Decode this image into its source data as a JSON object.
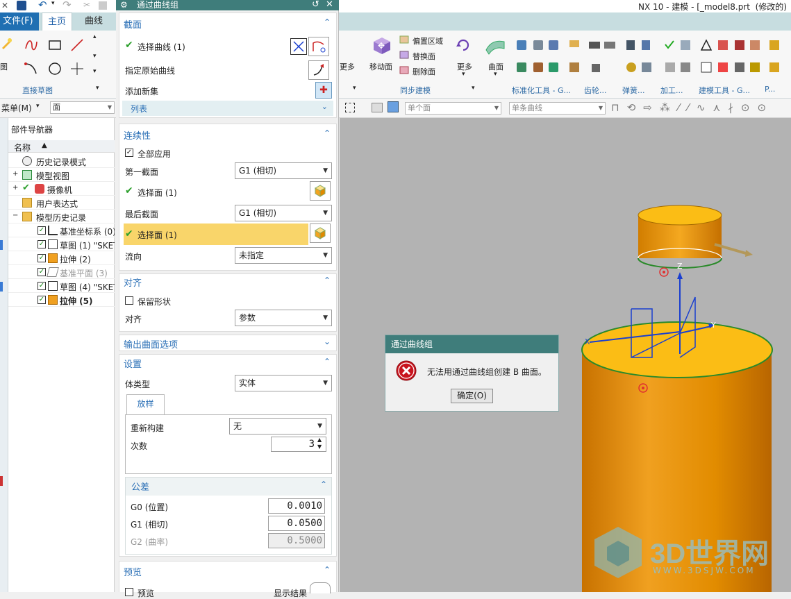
{
  "window": {
    "title": "NX 10 - 建模 - [_model8.prt  (修改的)"
  },
  "ribbon": {
    "tabs": [
      "文件(F)",
      "主页",
      "曲线"
    ],
    "group_direct_sketch": "直接草图",
    "left_partial_label": "图",
    "more_left": "更多",
    "move_face": "移动面",
    "offset_region": "偏置区域",
    "replace_face": "替换面",
    "delete_face": "删除面",
    "sync_modeling": "同步建模",
    "more": "更多",
    "surface": "曲面",
    "group_labels": [
      "标准化工具 - G...",
      "齿轮...",
      "弹簧...",
      "加工...",
      "建模工具 - G...",
      "P..."
    ]
  },
  "cmdrow": {
    "menu": "菜单(M)",
    "filter": "面",
    "face_filter": "单个面",
    "curve_filter": "单条曲线"
  },
  "navigator": {
    "title": "部件导航器",
    "col_name": "名称",
    "items": [
      {
        "label": "历史记录模式",
        "icon": "history-clock-icon"
      },
      {
        "label": "模型视图",
        "icon": "model-views-icon"
      },
      {
        "label": "摄像机",
        "icon": "camera-icon"
      },
      {
        "label": "用户表达式",
        "icon": "folder-icon"
      },
      {
        "label": "模型历史记录",
        "icon": "folder-icon"
      },
      {
        "label": "基准坐标系 (0)",
        "icon": "datum-csys-icon"
      },
      {
        "label": "草图 (1) \"SKET",
        "icon": "sketch-icon"
      },
      {
        "label": "拉伸 (2)",
        "icon": "extrude-icon"
      },
      {
        "label": "基准平面 (3)",
        "icon": "datum-plane-icon"
      },
      {
        "label": "草图 (4) \"SKET",
        "icon": "sketch-icon"
      },
      {
        "label": "拉伸 (5)",
        "icon": "extrude-icon"
      }
    ]
  },
  "dialog": {
    "title": "通过曲线组",
    "section": {
      "title": "截面",
      "select_curve": "选择曲线 (1)",
      "specify_origin": "指定原始曲线",
      "add_new_set": "添加新集",
      "list": "列表"
    },
    "continuity": {
      "title": "连续性",
      "apply_all": "全部应用",
      "first_section": "第一截面",
      "first_value": "G1 (相切)",
      "select_face1": "选择面 (1)",
      "last_section": "最后截面",
      "last_value": "G1 (相切)",
      "select_face2": "选择面 (1)",
      "flow_dir": "流向",
      "flow_value": "未指定"
    },
    "alignment": {
      "title": "对齐",
      "preserve_shape": "保留形状",
      "align": "对齐",
      "align_value": "参数"
    },
    "output_options": {
      "title": "输出曲面选项"
    },
    "settings": {
      "title": "设置",
      "body_type": "体类型",
      "body_value": "实体",
      "tab_lofting": "放样",
      "rebuild": "重新构建",
      "rebuild_value": "无",
      "degree": "次数",
      "degree_value": "3"
    },
    "tolerance": {
      "title": "公差",
      "g0": "G0 (位置)",
      "g0_value": "0.0010",
      "g1": "G1 (相切)",
      "g1_value": "0.0500",
      "g2": "G2 (曲率)",
      "g2_value": "0.5000"
    },
    "preview": {
      "title": "预览",
      "preview_cb": "预览",
      "show_result": "显示结果"
    }
  },
  "alert": {
    "title": "通过曲线组",
    "message": "无法用通过曲线组创建 B 曲面。",
    "ok": "确定(O)"
  },
  "viewport": {
    "axis_z": "Z",
    "axis_x": "X",
    "axis_y": "Y"
  },
  "watermark": {
    "brand": "3D世界网",
    "url": "WWW.3DSJW.COM"
  },
  "colors": {
    "dialog_header": "#3f7d7b",
    "section_title": "#2a6fb6",
    "solid_orange": "#e88f00",
    "highlight_row": "#f9d56a"
  }
}
